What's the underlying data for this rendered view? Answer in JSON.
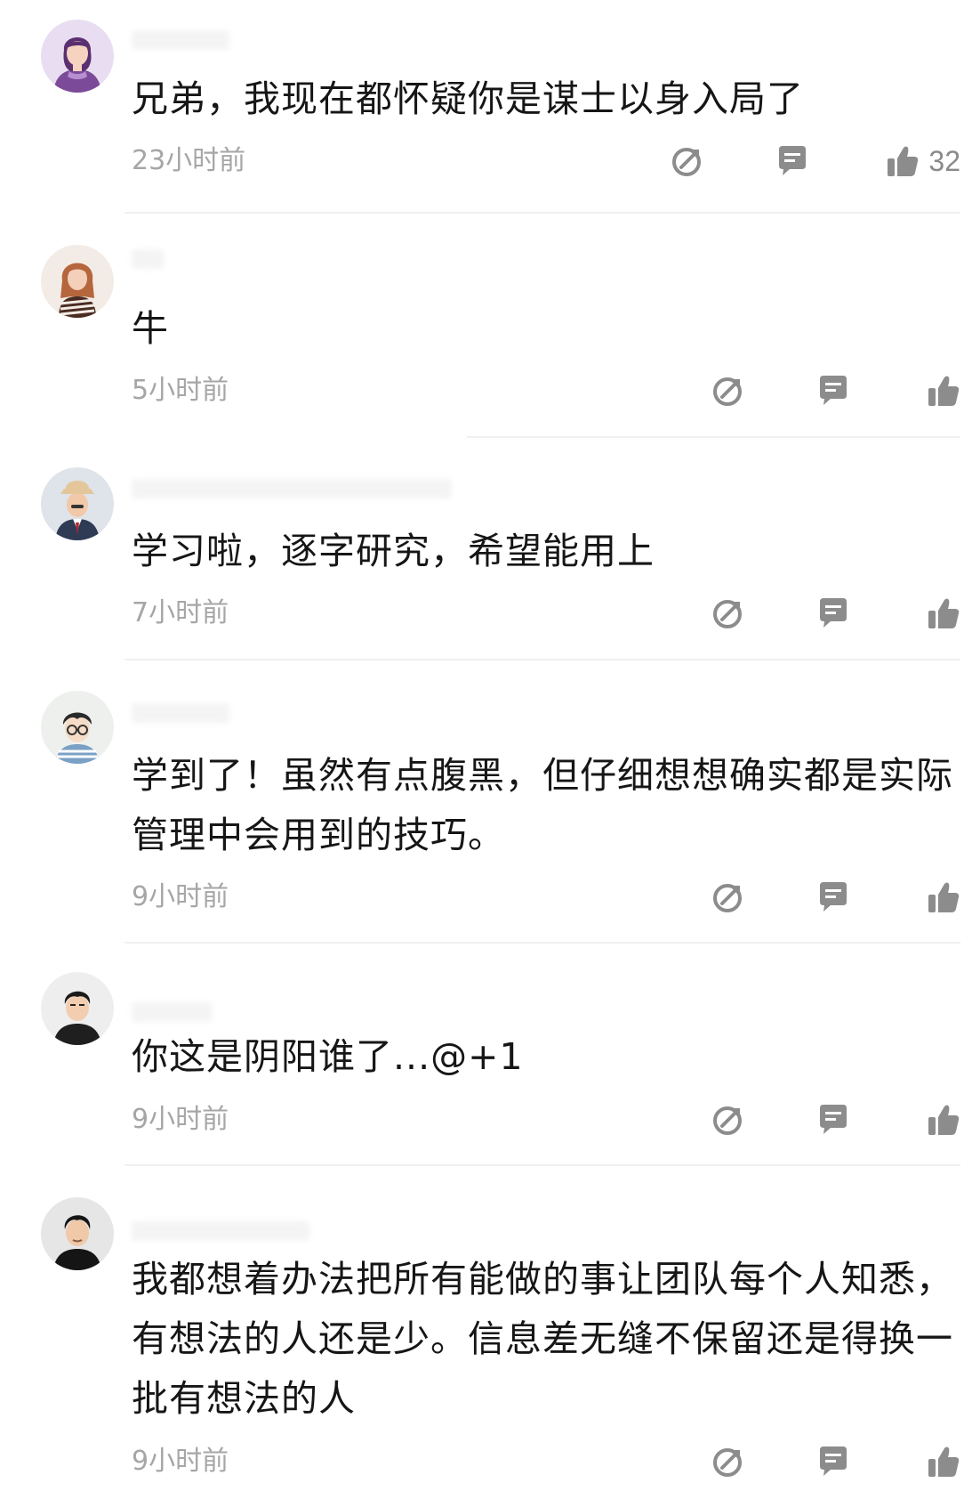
{
  "colors": {
    "text": "#161616",
    "muted": "#a6a6a6",
    "icon": "#8c8c8c",
    "divider": "#f0f0f0"
  },
  "comments": [
    {
      "text": "兄弟，我现在都怀疑你是谋士以身入局了",
      "time": "23小时前",
      "likes": "32",
      "avatar": "woman-purple-avatar"
    },
    {
      "text": "牛",
      "time": "5小时前",
      "likes": "",
      "avatar": "woman-longhair-avatar"
    },
    {
      "text": "学习啦，逐字研究，希望能用上",
      "time": "7小时前",
      "likes": "",
      "avatar": "man-hat-avatar"
    },
    {
      "text": "学到了！虽然有点腹黑，但仔细想想确实都是实际管理中会用到的技巧。",
      "time": "9小时前",
      "likes": "",
      "avatar": "boy-glasses-avatar"
    },
    {
      "text": "你这是阴阳谁了...@+1",
      "time": "9小时前",
      "likes": "",
      "avatar": "man-black-shirt-avatar"
    },
    {
      "text": "我都想着办法把所有能做的事让团队每个人知悉，有想法的人还是少。信息差无缝不保留还是得换一批有想法的人",
      "time": "9小时前",
      "likes": "",
      "avatar": "man-suit-avatar"
    }
  ]
}
